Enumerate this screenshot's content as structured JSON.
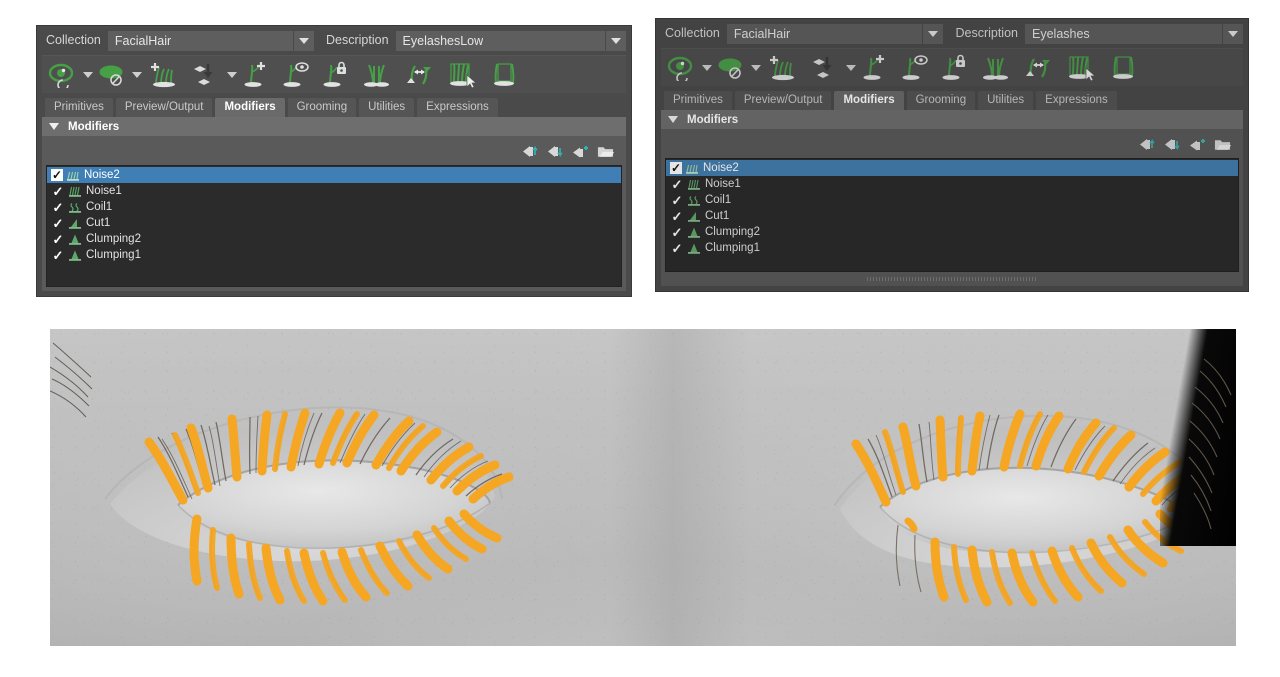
{
  "panels": [
    {
      "id": "left",
      "collection": {
        "label": "Collection",
        "value": "FacialHair"
      },
      "description": {
        "label": "Description",
        "value": "EyelashesLow"
      },
      "toolbar": [
        {
          "name": "eye-guides-icon",
          "caret": true
        },
        {
          "name": "surface-icon",
          "caret": true
        },
        {
          "name": "add-hair-icon",
          "caret": false
        },
        {
          "name": "plant-hair-icon",
          "caret": true
        },
        {
          "name": "add-guide-icon",
          "caret": false
        },
        {
          "name": "show-guides-icon",
          "caret": false
        },
        {
          "name": "lock-guide-icon",
          "caret": false
        },
        {
          "name": "split-guides-icon",
          "caret": false
        },
        {
          "name": "flip-guides-icon",
          "caret": false
        },
        {
          "name": "select-strands-icon",
          "caret": false
        },
        {
          "name": "frame-strands-icon",
          "caret": false
        }
      ],
      "tabs": [
        {
          "label": "Primitives",
          "active": false
        },
        {
          "label": "Preview/Output",
          "active": false
        },
        {
          "label": "Modifiers",
          "active": true
        },
        {
          "label": "Grooming",
          "active": false
        },
        {
          "label": "Utilities",
          "active": false
        },
        {
          "label": "Expressions",
          "active": false
        }
      ],
      "section": {
        "title": "Modifiers"
      },
      "stack_icons": [
        {
          "name": "move-up-icon"
        },
        {
          "name": "move-down-icon"
        },
        {
          "name": "add-modifier-icon"
        },
        {
          "name": "open-folder-icon"
        }
      ],
      "modifiers": [
        {
          "name": "Noise2",
          "checked": true,
          "selected": true,
          "icon": "noise-icon"
        },
        {
          "name": "Noise1",
          "checked": true,
          "selected": false,
          "icon": "noise-icon"
        },
        {
          "name": "Coil1",
          "checked": true,
          "selected": false,
          "icon": "coil-icon"
        },
        {
          "name": "Cut1",
          "checked": true,
          "selected": false,
          "icon": "cut-icon"
        },
        {
          "name": "Clumping2",
          "checked": true,
          "selected": false,
          "icon": "clumping-icon"
        },
        {
          "name": "Clumping1",
          "checked": true,
          "selected": false,
          "icon": "clumping-icon"
        }
      ],
      "has_hscroll": false
    },
    {
      "id": "right",
      "collection": {
        "label": "Collection",
        "value": "FacialHair"
      },
      "description": {
        "label": "Description",
        "value": "Eyelashes"
      },
      "toolbar": [
        {
          "name": "eye-guides-icon",
          "caret": true
        },
        {
          "name": "surface-icon",
          "caret": true
        },
        {
          "name": "add-hair-icon",
          "caret": false
        },
        {
          "name": "plant-hair-icon",
          "caret": true
        },
        {
          "name": "add-guide-icon",
          "caret": false
        },
        {
          "name": "show-guides-icon",
          "caret": false
        },
        {
          "name": "lock-guide-icon",
          "caret": false
        },
        {
          "name": "split-guides-icon",
          "caret": false
        },
        {
          "name": "flip-guides-icon",
          "caret": false
        },
        {
          "name": "select-strands-icon",
          "caret": false
        },
        {
          "name": "frame-strands-icon",
          "caret": false
        }
      ],
      "tabs": [
        {
          "label": "Primitives",
          "active": false
        },
        {
          "label": "Preview/Output",
          "active": false
        },
        {
          "label": "Modifiers",
          "active": true
        },
        {
          "label": "Grooming",
          "active": false
        },
        {
          "label": "Utilities",
          "active": false
        },
        {
          "label": "Expressions",
          "active": false
        }
      ],
      "section": {
        "title": "Modifiers"
      },
      "stack_icons": [
        {
          "name": "move-up-icon"
        },
        {
          "name": "move-down-icon"
        },
        {
          "name": "add-modifier-icon"
        },
        {
          "name": "open-folder-icon"
        }
      ],
      "modifiers": [
        {
          "name": "Noise2",
          "checked": true,
          "selected": true,
          "icon": "noise-icon"
        },
        {
          "name": "Noise1",
          "checked": true,
          "selected": false,
          "icon": "noise-icon"
        },
        {
          "name": "Coil1",
          "checked": true,
          "selected": false,
          "icon": "coil-icon"
        },
        {
          "name": "Cut1",
          "checked": true,
          "selected": false,
          "icon": "cut-icon"
        },
        {
          "name": "Clumping2",
          "checked": true,
          "selected": false,
          "icon": "clumping-icon"
        },
        {
          "name": "Clumping1",
          "checked": true,
          "selected": false,
          "icon": "clumping-icon"
        }
      ],
      "has_hscroll": true
    }
  ],
  "viewport": {
    "name": "eyelash-render-viewport",
    "description": "Greyscale 3D render of a face showing both eyes with eyelash hair and orange guide strands",
    "guide_color": "#f5a623",
    "hair_color": "#6b6257",
    "skin_color": "#bdbdbd"
  },
  "colors": {
    "panel_bg": "#4a4a4a",
    "toolbar_bg": "#4f4f4f",
    "field_bg": "#5e5e5e",
    "tab_active_bg": "#6a6a6a",
    "list_bg": "#2b2b2b",
    "selection_blue": "#3f7fb5",
    "icon_green": "#4a9c4a",
    "icon_teal": "#3aa7a7"
  }
}
